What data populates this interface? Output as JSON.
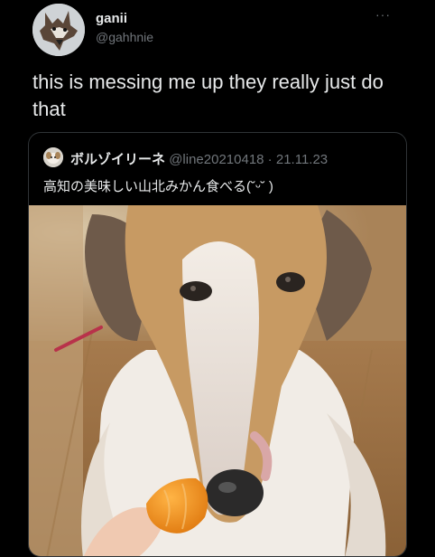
{
  "author": {
    "display_name": "ganii",
    "handle": "@gahhnie",
    "avatar_icon": "wolf-avatar-icon"
  },
  "menu_icon": "more-options-icon",
  "more_glyph": "···",
  "tweet_text": "this is messing me up they really just do that",
  "quoted_tweet": {
    "display_name": "ボルゾイリーネ",
    "handle": "@line20210418",
    "separator": " · ",
    "date": "21.11.23",
    "text": "高知の美味しい山北みかん食べる(˘ᵕ˘ )",
    "avatar_icon": "dog-avatar-icon"
  },
  "photo": {
    "subject": "borzoi-dog-with-mandarin-photo"
  },
  "colors": {
    "background": "#000000",
    "text": "#e7e9ea",
    "muted": "#71767b",
    "border": "#2f3336"
  }
}
